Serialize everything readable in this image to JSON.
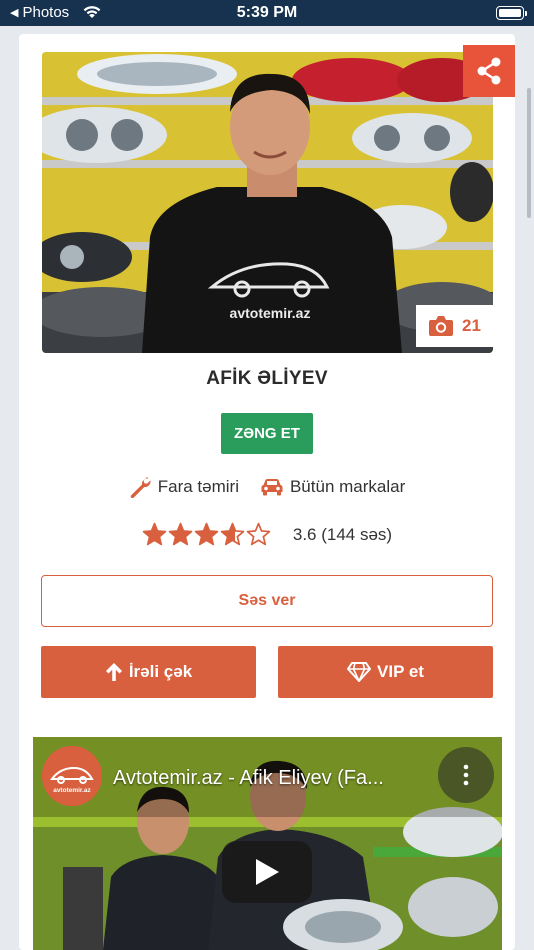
{
  "status_bar": {
    "back_label": "Photos",
    "time": "5:39 PM"
  },
  "master": {
    "name": "AFİK ƏLİYEV",
    "photo_count": "21",
    "call_label": "ZƏNG ET",
    "service_tag": "Fara təmiri",
    "brand_tag": "Bütün markalar",
    "rating_value": 3.6,
    "rating_text": "3.6 (144 səs)",
    "star_max": 5
  },
  "actions": {
    "vote_label": "Səs ver",
    "promote_label": "İrəli çək",
    "vip_label": "VIP et"
  },
  "photo_overlay": {
    "shirt_brand": "avtotemir.az"
  },
  "video": {
    "title": "Avtotemir.az - Afik Eliyev (Fa...",
    "channel_name": "avtotemir.az"
  },
  "colors": {
    "accent": "#d9603e",
    "share": "#e8543a",
    "call": "#2a9d5c",
    "status_bar": "#16324f"
  }
}
